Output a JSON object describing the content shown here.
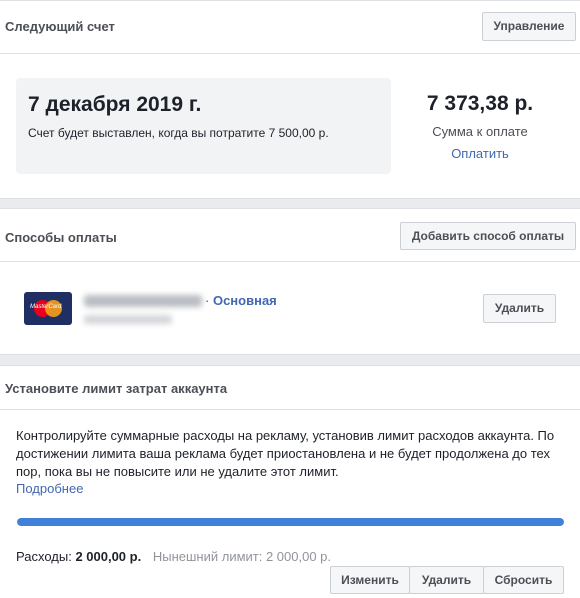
{
  "next_bill": {
    "title": "Следующий счет",
    "manage_label": "Управление",
    "date": "7 декабря 2019 г.",
    "note": "Счет будет выставлен, когда вы потратите 7 500,00 р.",
    "amount": "7 373,38 р.",
    "amount_label": "Сумма к оплате",
    "pay_label": "Оплатить"
  },
  "payment_methods": {
    "title": "Способы оплаты",
    "add_label": "Добавить способ оплаты",
    "card": {
      "brand_icon": "mastercard-icon",
      "brand_text": "MasterCard",
      "separator": "·",
      "primary_label": "Основная",
      "delete_label": "Удалить"
    }
  },
  "spend_limit": {
    "title": "Установите лимит затрат аккаунта",
    "description": "Контролируйте суммарные расходы на рекламу, установив лимит расходов аккаунта. По достижении лимита ваша реклама будет приостановлена и не будет продолжена до тех пор, пока вы не повысите или не удалите этот лимит.",
    "more_label": "Подробнее",
    "progress_fraction": 1.0,
    "spent_label": "Расходы:",
    "spent_value": "2 000,00 р.",
    "current_limit": "Нынешний лимит: 2 000,00 р.",
    "buttons": {
      "edit": "Изменить",
      "delete": "Удалить",
      "reset": "Сбросить"
    }
  },
  "colors": {
    "accent": "#4267b2",
    "progress": "#4080d8"
  }
}
